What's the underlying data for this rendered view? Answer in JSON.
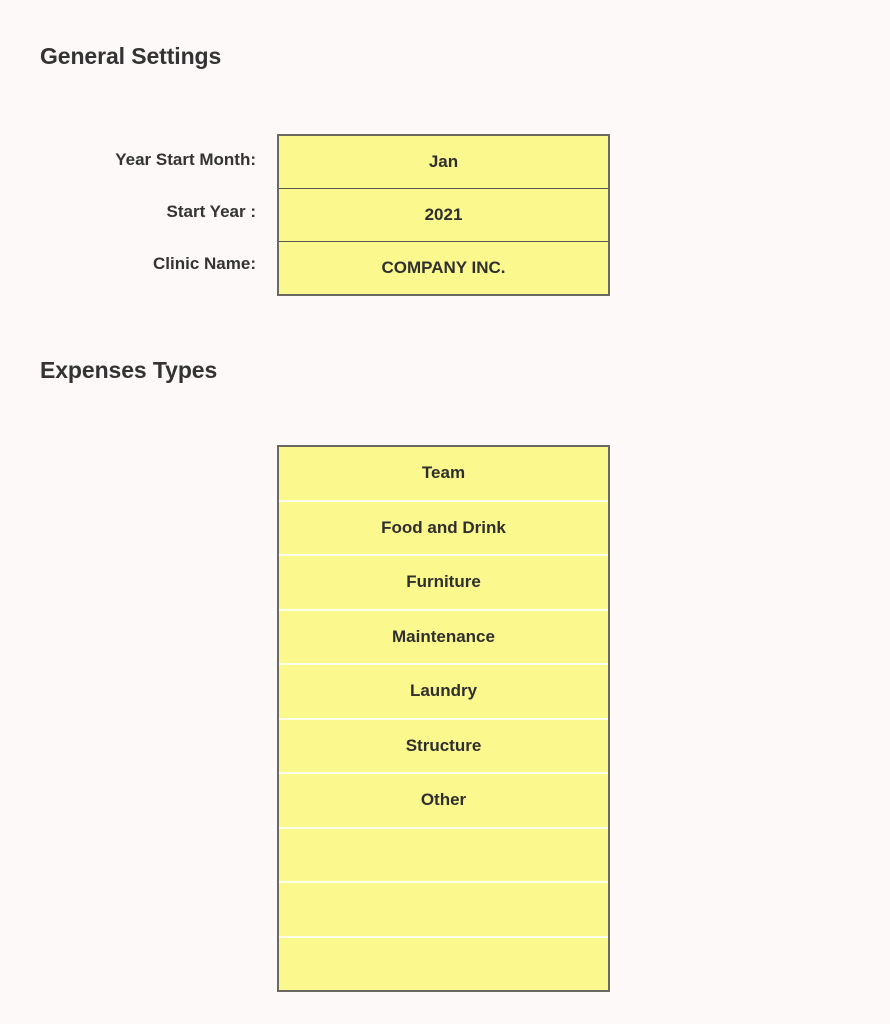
{
  "page": {
    "background_color": "#fdf9f8",
    "text_color": "#333333",
    "field_fill_color": "#fbf88d",
    "field_border_color": "#6b6a62"
  },
  "general_settings": {
    "heading": "General Settings",
    "fields": [
      {
        "label": "Year Start Month:",
        "value": "Jan"
      },
      {
        "label": "Start Year :",
        "value": "2021"
      },
      {
        "label": "Clinic Name:",
        "value": "COMPANY INC."
      }
    ]
  },
  "expenses_types": {
    "heading": "Expenses Types",
    "rows": [
      {
        "value": "Team"
      },
      {
        "value": "Food and Drink"
      },
      {
        "value": "Furniture"
      },
      {
        "value": "Maintenance"
      },
      {
        "value": "Laundry"
      },
      {
        "value": "Structure"
      },
      {
        "value": "Other"
      },
      {
        "value": ""
      },
      {
        "value": ""
      },
      {
        "value": ""
      }
    ]
  }
}
